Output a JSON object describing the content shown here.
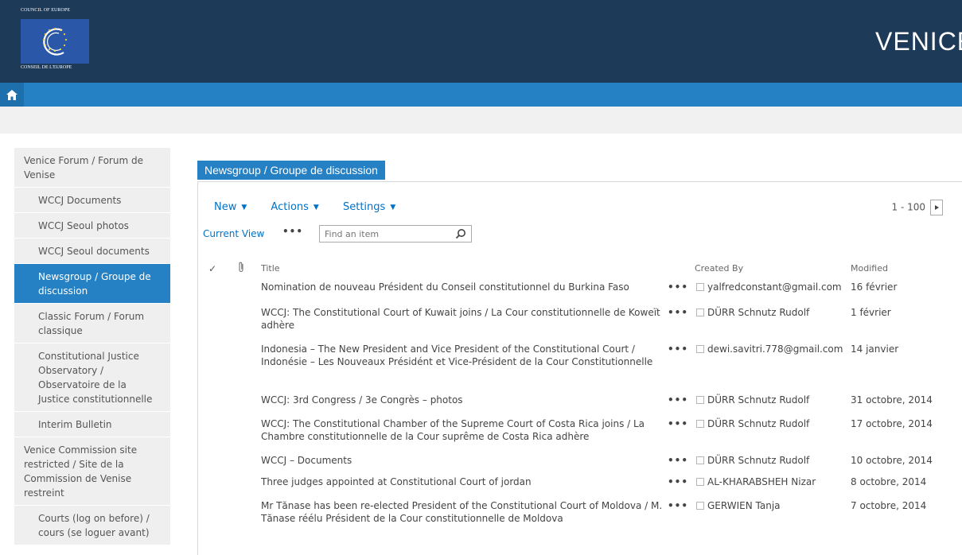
{
  "header": {
    "logo_top": "COUNCIL OF EUROPE",
    "logo_bottom": "CONSEIL DE L'EUROPE",
    "site_title": "VENICE"
  },
  "nav": {
    "home_icon": "home-icon"
  },
  "leftnav": {
    "items": [
      {
        "label": "Venice Forum / Forum de Venise",
        "level": 0,
        "selected": false
      },
      {
        "label": "WCCJ Documents",
        "level": 1,
        "selected": false
      },
      {
        "label": "WCCJ Seoul photos",
        "level": 1,
        "selected": false
      },
      {
        "label": "WCCJ Seoul documents",
        "level": 1,
        "selected": false
      },
      {
        "label": "Newsgroup / Groupe de discussion",
        "level": 1,
        "selected": true
      },
      {
        "label": "Classic Forum / Forum classique",
        "level": 1,
        "selected": false
      },
      {
        "label": "Constitutional Justice Observatory / Observatoire de la Justice constitutionnelle",
        "level": 1,
        "selected": false
      },
      {
        "label": "Interim Bulletin",
        "level": 1,
        "selected": false
      },
      {
        "label": "Venice Commission site restricted / Site de la Commission de Venise restreint",
        "level": 0,
        "selected": false
      },
      {
        "label": "Courts (log on before) / cours (se loguer avant)",
        "level": 1,
        "selected": false
      }
    ]
  },
  "content": {
    "web_title": "Newsgroup / Groupe de discussion",
    "toolbar": {
      "new_label": "New",
      "actions_label": "Actions",
      "settings_label": "Settings"
    },
    "pager": {
      "range": "1 - 100"
    },
    "view": {
      "current_view_label": "Current View",
      "more_label": "•••",
      "search_placeholder": "Find an item"
    },
    "columns": {
      "check": "✓",
      "attachment_icon": "paperclip-icon",
      "title": "Title",
      "created_by": "Created By",
      "modified": "Modified"
    },
    "rows": [
      {
        "title": "Nomination de nouveau Président du Conseil constitutionnel du Burkina Faso",
        "author": "yalfredconstant@gmail.com",
        "modified": "16 février"
      },
      {
        "title": "WCCJ: The Constitutional Court of Kuwait joins / La Cour constitutionnelle de Koweït adhère",
        "author": "DÜRR Schnutz Rudolf",
        "modified": "1 février"
      },
      {
        "title": "Indonesia – The New President and Vice President of the Constitutional Court / Indonésie – Les Nouveaux Présidént et Vice-Président de la Cour Constitutionnelle",
        "author": "dewi.savitri.778@gmail.com",
        "modified": "14 janvier"
      },
      {
        "title": "WCCJ: 3rd Congress / 3e Congrès – photos",
        "author": "DÜRR Schnutz Rudolf",
        "modified": "31 octobre, 2014"
      },
      {
        "title": "WCCJ: The Constitutional Chamber of the Supreme Court of Costa Rica joins / La Chambre constitutionnelle de la Cour suprême de Costa Rica adhère",
        "author": "DÜRR Schnutz Rudolf",
        "modified": "17 octobre, 2014"
      },
      {
        "title": "WCCJ – Documents",
        "author": "DÜRR Schnutz Rudolf",
        "modified": "10 octobre, 2014"
      },
      {
        "title": "Three judges appointed at Constitutional Court of jordan",
        "author": "AL-KHARABSHEH Nizar",
        "modified": "8 octobre, 2014"
      },
      {
        "title": "Mr Tănase has been re-elected President of the Constitutional Court of Moldova / M. Tănase réélu Président de la Cour constitutionnelle de Moldova",
        "author": "GERWIEN Tanja",
        "modified": "7 octobre, 2014"
      }
    ],
    "row_more_label": "•••"
  }
}
